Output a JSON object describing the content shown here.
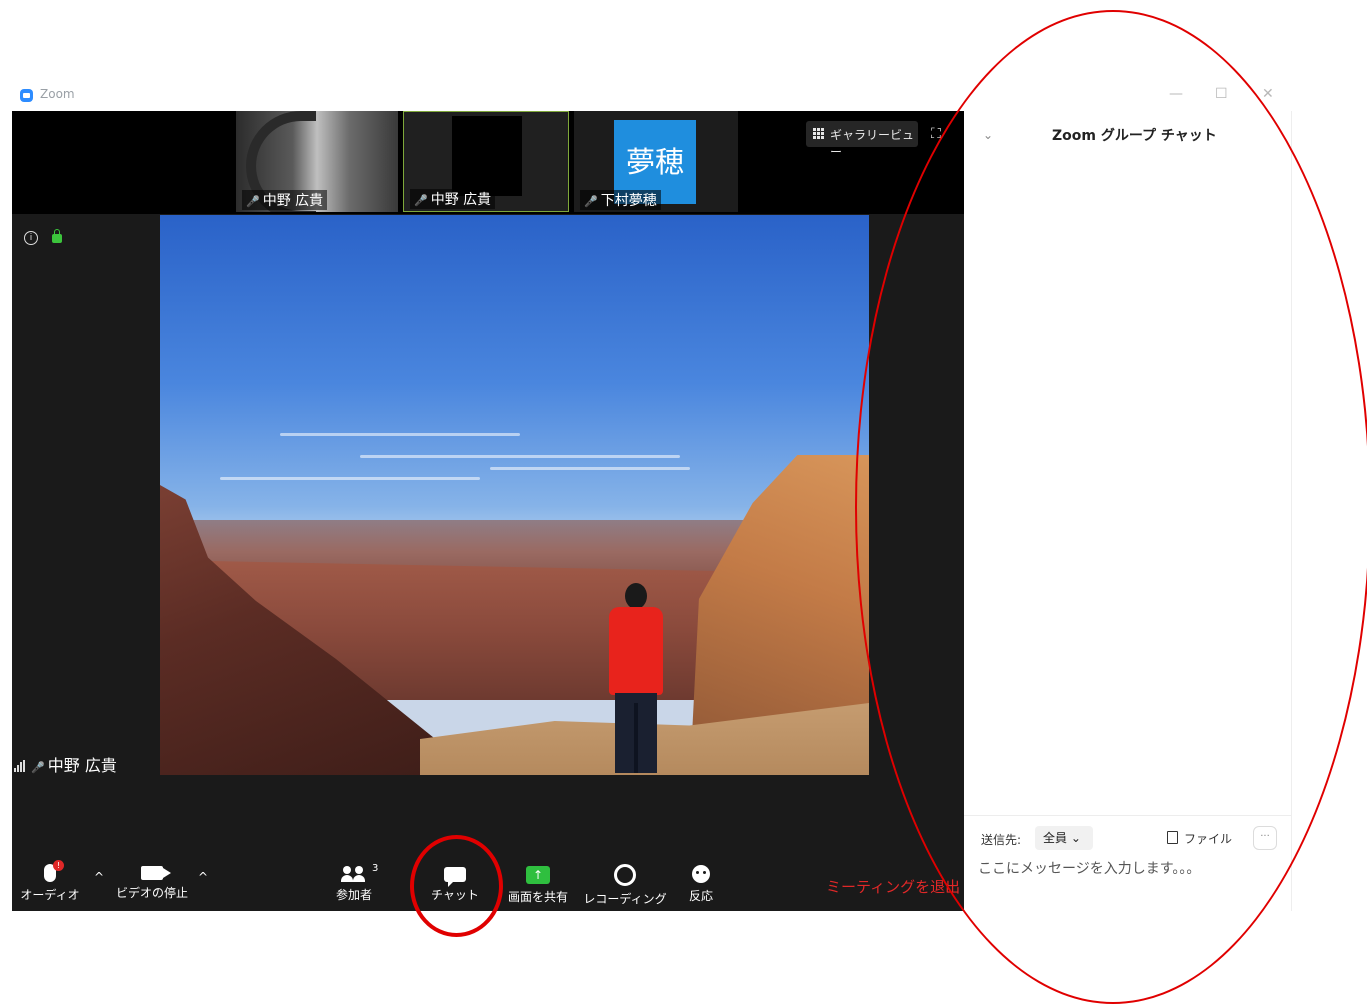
{
  "window": {
    "title": "Zoom",
    "minimize": "—",
    "maximize": "☐",
    "close": "✕"
  },
  "thumbnails": [
    {
      "name": "中野 広貴"
    },
    {
      "name": "中野 広貴"
    },
    {
      "name": "下村夢穂",
      "avatar_text": "夢穂",
      "avatar_color": "#1f8ede"
    }
  ],
  "view": {
    "gallery_label": "ギャラリービュー",
    "fullscreen": "⛶"
  },
  "main_speaker": {
    "name": "中野 広貴"
  },
  "toolbar": {
    "audio_label": "オーディオ",
    "audio_badge": "!",
    "video_label": "ビデオの停止",
    "participants_label": "参加者",
    "participants_count": "3",
    "chat_label": "チャット",
    "share_label": "画面を共有",
    "record_label": "レコーディング",
    "reactions_label": "反応",
    "end_label": "ミーティングを退出",
    "caret": "^"
  },
  "chat": {
    "title": "Zoom グループ チャット",
    "chevron": "⌄",
    "to_label": "送信先:",
    "to_value": "全員 ⌄",
    "file_label": "ファイル",
    "more": "···",
    "placeholder": "ここにメッセージを入力します。。。"
  },
  "colors": {
    "annotation": "#e00000",
    "end_meeting": "#e02828",
    "share_green": "#2fbf3f"
  }
}
